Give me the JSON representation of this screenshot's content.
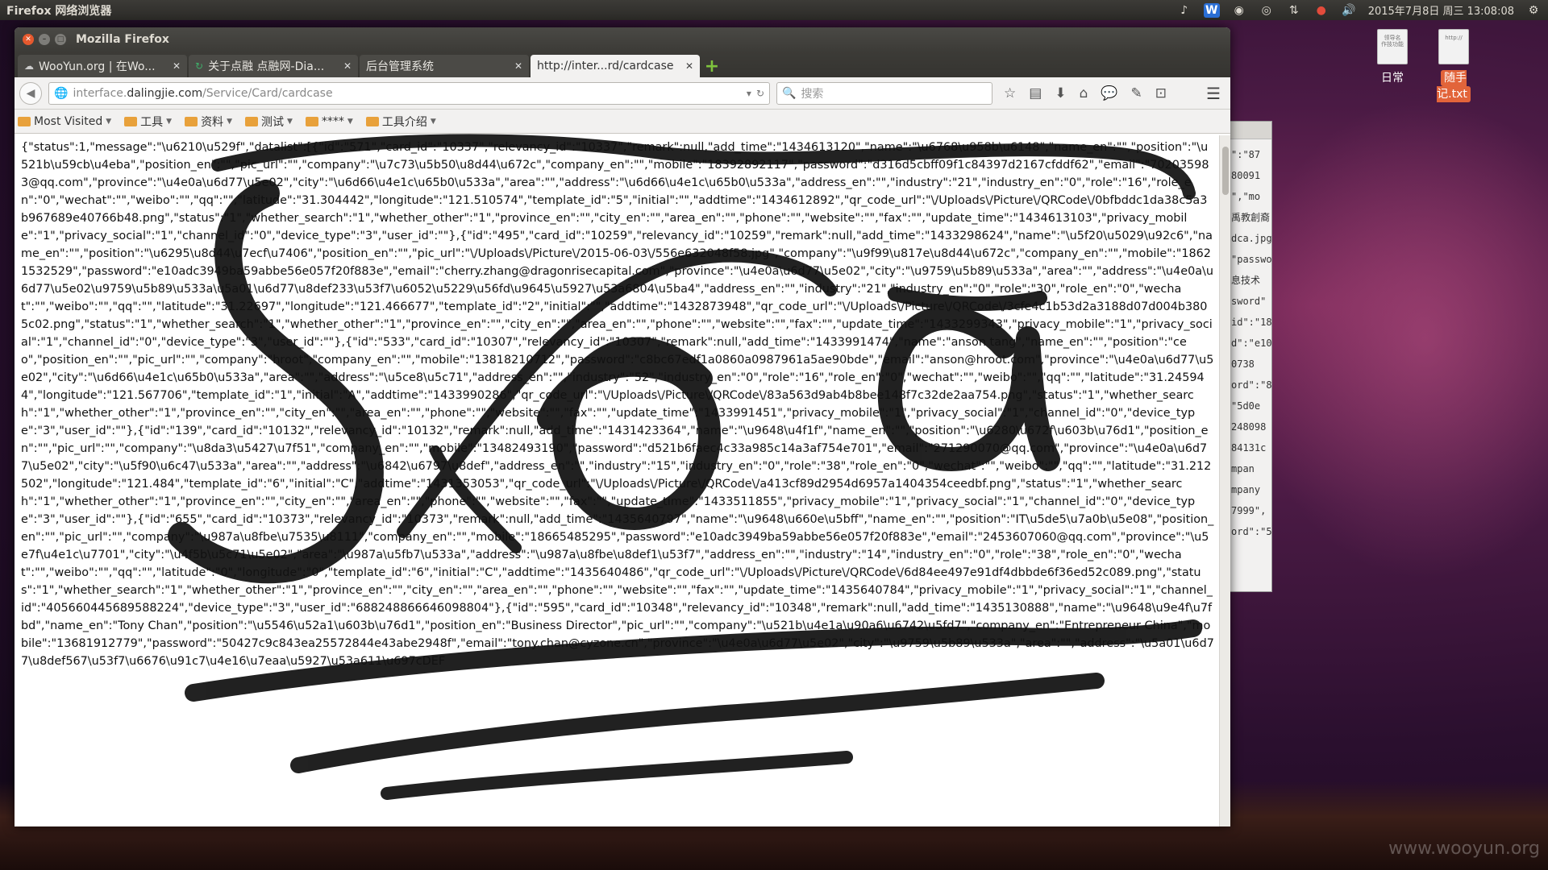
{
  "panel": {
    "title": "Firefox 网络浏览器",
    "clock": "2015年7月8日 周三 13:08:08"
  },
  "desktop": {
    "icons": [
      {
        "label": "日常",
        "file_text": "领导名\n作技功能"
      },
      {
        "label": "随手记.txt",
        "file_text": "http://"
      }
    ],
    "watermark": "www.wooyun.org",
    "bg_window_lines": [
      "\":\"87",
      "80091",
      "\",\"mo",
      "禹教創裔",
      "dca.jpg",
      "\"passwor",
      "息技术",
      "sword\"",
      "id\":\"184",
      "d\":\"e10",
      "0738",
      "ord\":\"8",
      "\"5d0e",
      "248098",
      "84131c",
      "mpan",
      "mpany",
      "7999\",",
      "ord\":\"5"
    ]
  },
  "window": {
    "title": "Mozilla Firefox"
  },
  "tabs": [
    {
      "label": "WooYun.org | 在Wo...",
      "active": false
    },
    {
      "label": "关于点融 点融网-Dia...",
      "active": false
    },
    {
      "label": "后台管理系统",
      "active": false
    },
    {
      "label": "http://inter...rd/cardcase",
      "active": true
    }
  ],
  "navbar": {
    "url_prefix": "interface.",
    "url_domain": "dalingjie.com",
    "url_path": "/Service/Card/cardcase",
    "search_placeholder": "搜索"
  },
  "bookmarks": [
    {
      "label": "Most Visited"
    },
    {
      "label": "工具"
    },
    {
      "label": "资料"
    },
    {
      "label": "测试"
    },
    {
      "label": "****"
    },
    {
      "label": "工具介绍"
    }
  ],
  "page": {
    "json_text": "{\"status\":1,\"message\":\"\\u6210\\u529f\",\"datalist\":[{\"id\":\"571\",\"card_id\":\"10337\",\"relevancy_id\":\"10337\",\"remark\":null,\"add_time\":\"1434613120\",\"name\":\"\\u6768\\u958b\\u6148\",\"name_en\":\"\",\"position\":\"\\u521b\\u59cb\\u4eba\",\"position_en\":\"\",\"pic_url\":\"\",\"company\":\"\\u7c73\\u5b50\\u8d44\\u672c\",\"company_en\":\"\",\"mobile\":\"18392892117\",\"password\":\"d316d5cbff09f1c84397d2167cfddf62\",\"email\":\"702035983@qq.com\",\"province\":\"\\u4e0a\\u6d77\\u5e02\",\"city\":\"\\u6d66\\u4e1c\\u65b0\\u533a\",\"area\":\"\",\"address\":\"\\u6d66\\u4e1c\\u65b0\\u533a\",\"address_en\":\"\",\"industry\":\"21\",\"industry_en\":\"0\",\"role\":\"16\",\"role_en\":\"0\",\"wechat\":\"\",\"weibo\":\"\",\"qq\":\"\",\"latitude\":\"31.304442\",\"longitude\":\"121.510574\",\"template_id\":\"5\",\"initial\":\"\",\"addtime\":\"1434612892\",\"qr_code_url\":\"\\/Uploads\\/Picture\\/QRCode\\/0bfbddc1da38c5a3b967689e40766b48.png\",\"status\":\"1\",\"whether_search\":\"1\",\"whether_other\":\"1\",\"province_en\":\"\",\"city_en\":\"\",\"area_en\":\"\",\"phone\":\"\",\"website\":\"\",\"fax\":\"\",\"update_time\":\"1434613103\",\"privacy_mobile\":\"1\",\"privacy_social\":\"1\",\"channel_id\":\"0\",\"device_type\":\"3\",\"user_id\":\"\"},{\"id\":\"495\",\"card_id\":\"10259\",\"relevancy_id\":\"10259\",\"remark\":null,\"add_time\":\"1433298624\",\"name\":\"\\u5f20\\u5029\\u92c6\",\"name_en\":\"\",\"position\":\"\\u6295\\u8d44\\u7ecf\\u7406\",\"position_en\":\"\",\"pic_url\":\"\\/Uploads\\/Picture\\/2015-06-03\\/556e632048f58.jpg\",\"company\":\"\\u9f99\\u817e\\u8d44\\u672c\",\"company_en\":\"\",\"mobile\":\"18621532529\",\"password\":\"e10adc3949ba59abbe56e057f20f883e\",\"email\":\"cherry.zhang@dragonrisecapital.com\",\"province\":\"\\u4e0a\\u6d77\\u5e02\",\"city\":\"\\u9759\\u5b89\\u533a\",\"area\":\"\",\"address\":\"\\u4e0a\\u6d77\\u5e02\\u9759\\u5b89\\u533a\\u5a01\\u6d77\\u8def233\\u53f7\\u6052\\u5229\\u56fd\\u9645\\u5927\\u53a6804\\u5ba4\",\"address_en\":\"\",\"industry\":\"21\",\"industry_en\":\"0\",\"role\":\"30\",\"role_en\":\"0\",\"wechat\":\"\",\"weibo\":\"\",\"qq\":\"\",\"latitude\":\"31.22697\",\"longitude\":\"121.466677\",\"template_id\":\"2\",\"initial\":\"\",\"addtime\":\"1432873948\",\"qr_code_url\":\"\\/Uploads\\/Picture\\/QRCode\\/3cfe4c1b53d2a3188d07d004b3805c02.png\",\"status\":\"1\",\"whether_search\":\"1\",\"whether_other\":\"1\",\"province_en\":\"\",\"city_en\":\"\",\"area_en\":\"\",\"phone\":\"\",\"website\":\"\",\"fax\":\"\",\"update_time\":\"1433299343\",\"privacy_mobile\":\"1\",\"privacy_social\":\"1\",\"channel_id\":\"0\",\"device_type\":\"3\",\"user_id\":\"\"},{\"id\":\"533\",\"card_id\":\"10307\",\"relevancy_id\":\"10307\",\"remark\":null,\"add_time\":\"1433991474\",\"name\":\"anson tang\",\"name_en\":\"\",\"position\":\"ceo\",\"position_en\":\"\",\"pic_url\":\"\",\"company\":\"hroot\",\"company_en\":\"\",\"mobile\":\"13818210712\",\"password\":\"c8bc67edf1a0860a0987961a5ae90bde\",\"email\":\"anson@hroot.com\",\"province\":\"\\u4e0a\\u6d77\\u5e02\",\"city\":\"\\u6d66\\u4e1c\\u65b0\\u533a\",\"area\":\"\",\"address\":\"\\u5ce8\\u5c71\",\"address_en\":\"\",\"industry\":\"52\",\"industry_en\":\"0\",\"role\":\"16\",\"role_en\":\"0\",\"wechat\":\"\",\"weibo\":\"\",\"qq\":\"\",\"latitude\":\"31.245944\",\"longitude\":\"121.567706\",\"template_id\":\"1\",\"initial\":\"A\",\"addtime\":\"1433990286\",\"qr_code_url\":\"\\/Uploads\\/Picture\\/QRCode\\/83a563d9ab4b8bee148f7c32de2aa754.png\",\"status\":\"1\",\"whether_search\":\"1\",\"whether_other\":\"1\",\"province_en\":\"\",\"city_en\":\"\",\"area_en\":\"\",\"phone\":\"\",\"website\":\"\",\"fax\":\"\",\"update_time\":\"1433991451\",\"privacy_mobile\":\"1\",\"privacy_social\":\"1\",\"channel_id\":\"0\",\"device_type\":\"3\",\"user_id\":\"\"},{\"id\":\"139\",\"card_id\":\"10132\",\"relevancy_id\":\"10132\",\"remark\":null,\"add_time\":\"1431423364\",\"name\":\"\\u9648\\u4f1f\",\"name_en\":\"\",\"position\":\"\\u6280\\u672f\\u603b\\u76d1\",\"position_en\":\"\",\"pic_url\":\"\",\"company\":\"\\u8da3\\u5427\\u7f51\",\"company_en\":\"\",\"mobile\":\"13482493190\",\"password\":\"d521b6faec4c33a985c14a3af754e701\",\"email\":\"271290070@qq.com\",\"province\":\"\\u4e0a\\u6d77\\u5e02\",\"city\":\"\\u5f90\\u6c47\\u533a\",\"area\":\"\",\"address\":\"\\u6842\\u6797\\u8def\",\"address_en\":\"\",\"industry\":\"15\",\"industry_en\":\"0\",\"role\":\"38\",\"role_en\":\"0\",\"wechat\":\"\",\"weibo\":\"\",\"qq\":\"\",\"latitude\":\"31.212502\",\"longitude\":\"121.484\",\"template_id\":\"6\",\"initial\":\"C\",\"addtime\":\"1431353053\",\"qr_code_url\":\"\\/Uploads\\/Picture\\/QRCode\\/a413cf89d2954d6957a1404354ceedbf.png\",\"status\":\"1\",\"whether_search\":\"1\",\"whether_other\":\"1\",\"province_en\":\"\",\"city_en\":\"\",\"area_en\":\"\",\"phone\":\"\",\"website\":\"\",\"fax\":\"\",\"update_time\":\"1433511855\",\"privacy_mobile\":\"1\",\"privacy_social\":\"1\",\"channel_id\":\"0\",\"device_type\":\"3\",\"user_id\":\"\"},{\"id\":\"655\",\"card_id\":\"10373\",\"relevancy_id\":\"10373\",\"remark\":null,\"add_time\":\"1435640797\",\"name\":\"\\u9648\\u660e\\u5bff\",\"name_en\":\"\",\"position\":\"IT\\u5de5\\u7a0b\\u5e08\",\"position_en\":\"\",\"pic_url\":\"\",\"company\":\"\\u987a\\u8fbe\\u7535\\u8111\",\"company_en\":\"\",\"mobile\":\"18665485295\",\"password\":\"e10adc3949ba59abbe56e057f20f883e\",\"email\":\"2453607060@qq.com\",\"province\":\"\\u5e7f\\u4e1c\\u7701\",\"city\":\"\\u4f5b\\u5c71\\u5e02\",\"area\":\"\\u987a\\u5fb7\\u533a\",\"address\":\"\\u987a\\u8fbe\\u8def1\\u53f7\",\"address_en\":\"\",\"industry\":\"14\",\"industry_en\":\"0\",\"role\":\"38\",\"role_en\":\"0\",\"wechat\":\"\",\"weibo\":\"\",\"qq\":\"\",\"latitude\":\"0\",\"longitude\":\"0\",\"template_id\":\"6\",\"initial\":\"C\",\"addtime\":\"1435640486\",\"qr_code_url\":\"\\/Uploads\\/Picture\\/QRCode\\/6d84ee497e91df4dbbde6f36ed52c089.png\",\"status\":\"1\",\"whether_search\":\"1\",\"whether_other\":\"1\",\"province_en\":\"\",\"city_en\":\"\",\"area_en\":\"\",\"phone\":\"\",\"website\":\"\",\"fax\":\"\",\"update_time\":\"1435640784\",\"privacy_mobile\":\"1\",\"privacy_social\":\"1\",\"channel_id\":\"405660445689588224\",\"device_type\":\"3\",\"user_id\":\"688248866646098804\"},{\"id\":\"595\",\"card_id\":\"10348\",\"relevancy_id\":\"10348\",\"remark\":null,\"add_time\":\"1435130888\",\"name\":\"\\u9648\\u9e4f\\u7fbd\",\"name_en\":\"Tony Chan\",\"position\":\"\\u5546\\u52a1\\u603b\\u76d1\",\"position_en\":\"Business Director\",\"pic_url\":\"\",\"company\":\"\\u521b\\u4e1a\\u90a6\\u6742\\u5fd7\",\"company_en\":\"Entrepreneur China\",\"mobile\":\"13681912779\",\"password\":\"50427c9c843ea25572844e43abe2948f\",\"email\":\"tony.chan@cyzone.cn\",\"province\":\"\\u4e0a\\u6d77\\u5e02\",\"city\":\"\\u9759\\u5b89\\u533a\",\"area\":\"\",\"address\":\"\\u5a01\\u6d77\\u8def567\\u53f7\\u6676\\u91c7\\u4e16\\u7eaa\\u5927\\u53a611\\u697cDEF"
  },
  "colors": {
    "panel": "#3c3b37",
    "close_button": "#e6592e",
    "new_tab": "#7ec33d",
    "selected_desktop_label": "#e2643a",
    "folder": "#e8a13b"
  }
}
